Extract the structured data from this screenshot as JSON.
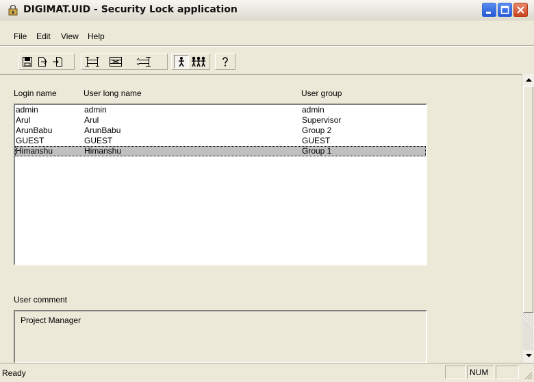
{
  "window": {
    "title": "DIGIMAT.UID - Security Lock application",
    "title_icon": "security-lock-app-icon"
  },
  "menu": [
    "File",
    "Edit",
    "View",
    "Help"
  ],
  "toolbar": {
    "buttons": [
      "save-icon",
      "export-icon",
      "import-icon",
      "add-entry-icon",
      "edit-entry-icon",
      "delete-entry-icon",
      "user-icon",
      "users-group-icon",
      "help-icon"
    ]
  },
  "users": {
    "columns": [
      "Login name",
      "User long name",
      "User group"
    ],
    "rows": [
      {
        "login": "admin",
        "long_name": "admin",
        "group": "admin",
        "selected": false
      },
      {
        "login": "Arul",
        "long_name": "Arul",
        "group": "Supervisor",
        "selected": false
      },
      {
        "login": "ArunBabu",
        "long_name": "ArunBabu",
        "group": "Group 2",
        "selected": false
      },
      {
        "login": "GUEST",
        "long_name": "GUEST",
        "group": "GUEST",
        "selected": false
      },
      {
        "login": "Himanshu",
        "long_name": "Himanshu",
        "group": "Group 1",
        "selected": true
      }
    ]
  },
  "comment": {
    "label": "User comment",
    "value": "Project Manager"
  },
  "status": {
    "text": "Ready",
    "num": "NUM"
  },
  "colors": {
    "selected_row": "#c0c0c0",
    "window_bg": "#ece9d8",
    "close_button": "#c8421c"
  }
}
